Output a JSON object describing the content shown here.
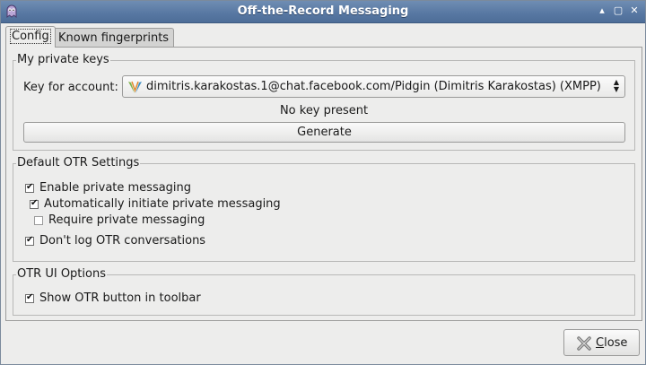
{
  "window": {
    "title": "Off-the-Record Messaging"
  },
  "tabs": [
    {
      "label": "Config",
      "selected": true
    },
    {
      "label": "Known fingerprints",
      "selected": false
    }
  ],
  "private_keys": {
    "title": "My private keys",
    "account_label": "Key for account:",
    "account_value": "dimitris.karakostas.1@chat.facebook.com/Pidgin (Dimitris Karakostas) (XMPP)",
    "account_icon": "xmpp-protocol-icon",
    "status": "No key present",
    "generate_label": "Generate"
  },
  "default_settings": {
    "title": "Default OTR Settings",
    "options": [
      {
        "label": "Enable private messaging",
        "checked": true
      },
      {
        "label": "Automatically initiate private messaging",
        "checked": true
      },
      {
        "label": "Require private messaging",
        "checked": false
      },
      {
        "label": "Don't log OTR conversations",
        "checked": true
      }
    ]
  },
  "ui_options": {
    "title": "OTR UI Options",
    "options": [
      {
        "label": "Show OTR button in toolbar",
        "checked": true
      }
    ]
  },
  "footer": {
    "close_mnemonic": "C",
    "close_rest": "lose",
    "close_icon": "close-x-icon"
  },
  "colors": {
    "titlebar": "#5979a3",
    "window_bg": "#ededec",
    "close_icon": "#777777"
  }
}
